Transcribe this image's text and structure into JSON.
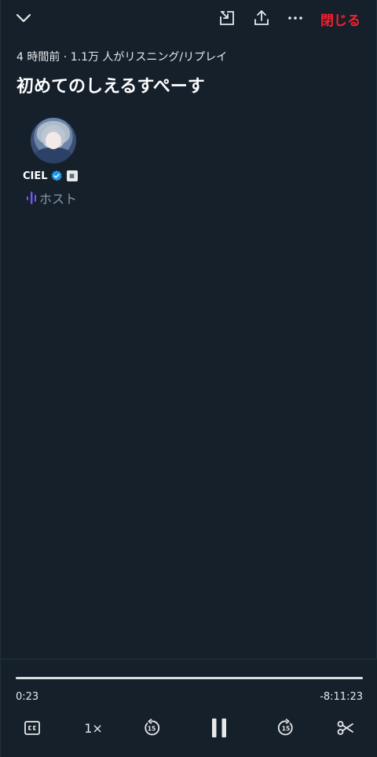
{
  "topbar": {
    "collapse_icon": "chevron-down-icon",
    "dock_icon": "dock-icon",
    "share_icon": "share-icon",
    "more_icon": "more-icon",
    "close_label": "閉じる"
  },
  "space": {
    "meta": "4 時間前 · 1.1万 人がリスニング/リプレイ",
    "title": "初めてのしえるすぺーす"
  },
  "host": {
    "name": "CIEL",
    "role": "ホスト",
    "verified": true,
    "avatar_icon": "avatar-image",
    "role_icon": "audio-bars-icon"
  },
  "player": {
    "progress": 0.001,
    "elapsed": "0:23",
    "remaining": "-8:11:23",
    "speed": "1×",
    "captions_icon": "cc-icon",
    "rewind_icon": "rewind-15-icon",
    "pause_icon": "pause-icon",
    "forward_icon": "forward-15-icon",
    "clip_icon": "scissors-icon"
  },
  "colors": {
    "background": "#15202b",
    "accent_red": "#f4212e",
    "verified_blue": "#1d9bf0",
    "role_purple": "#7856ff",
    "muted_text": "#8b98a5"
  }
}
